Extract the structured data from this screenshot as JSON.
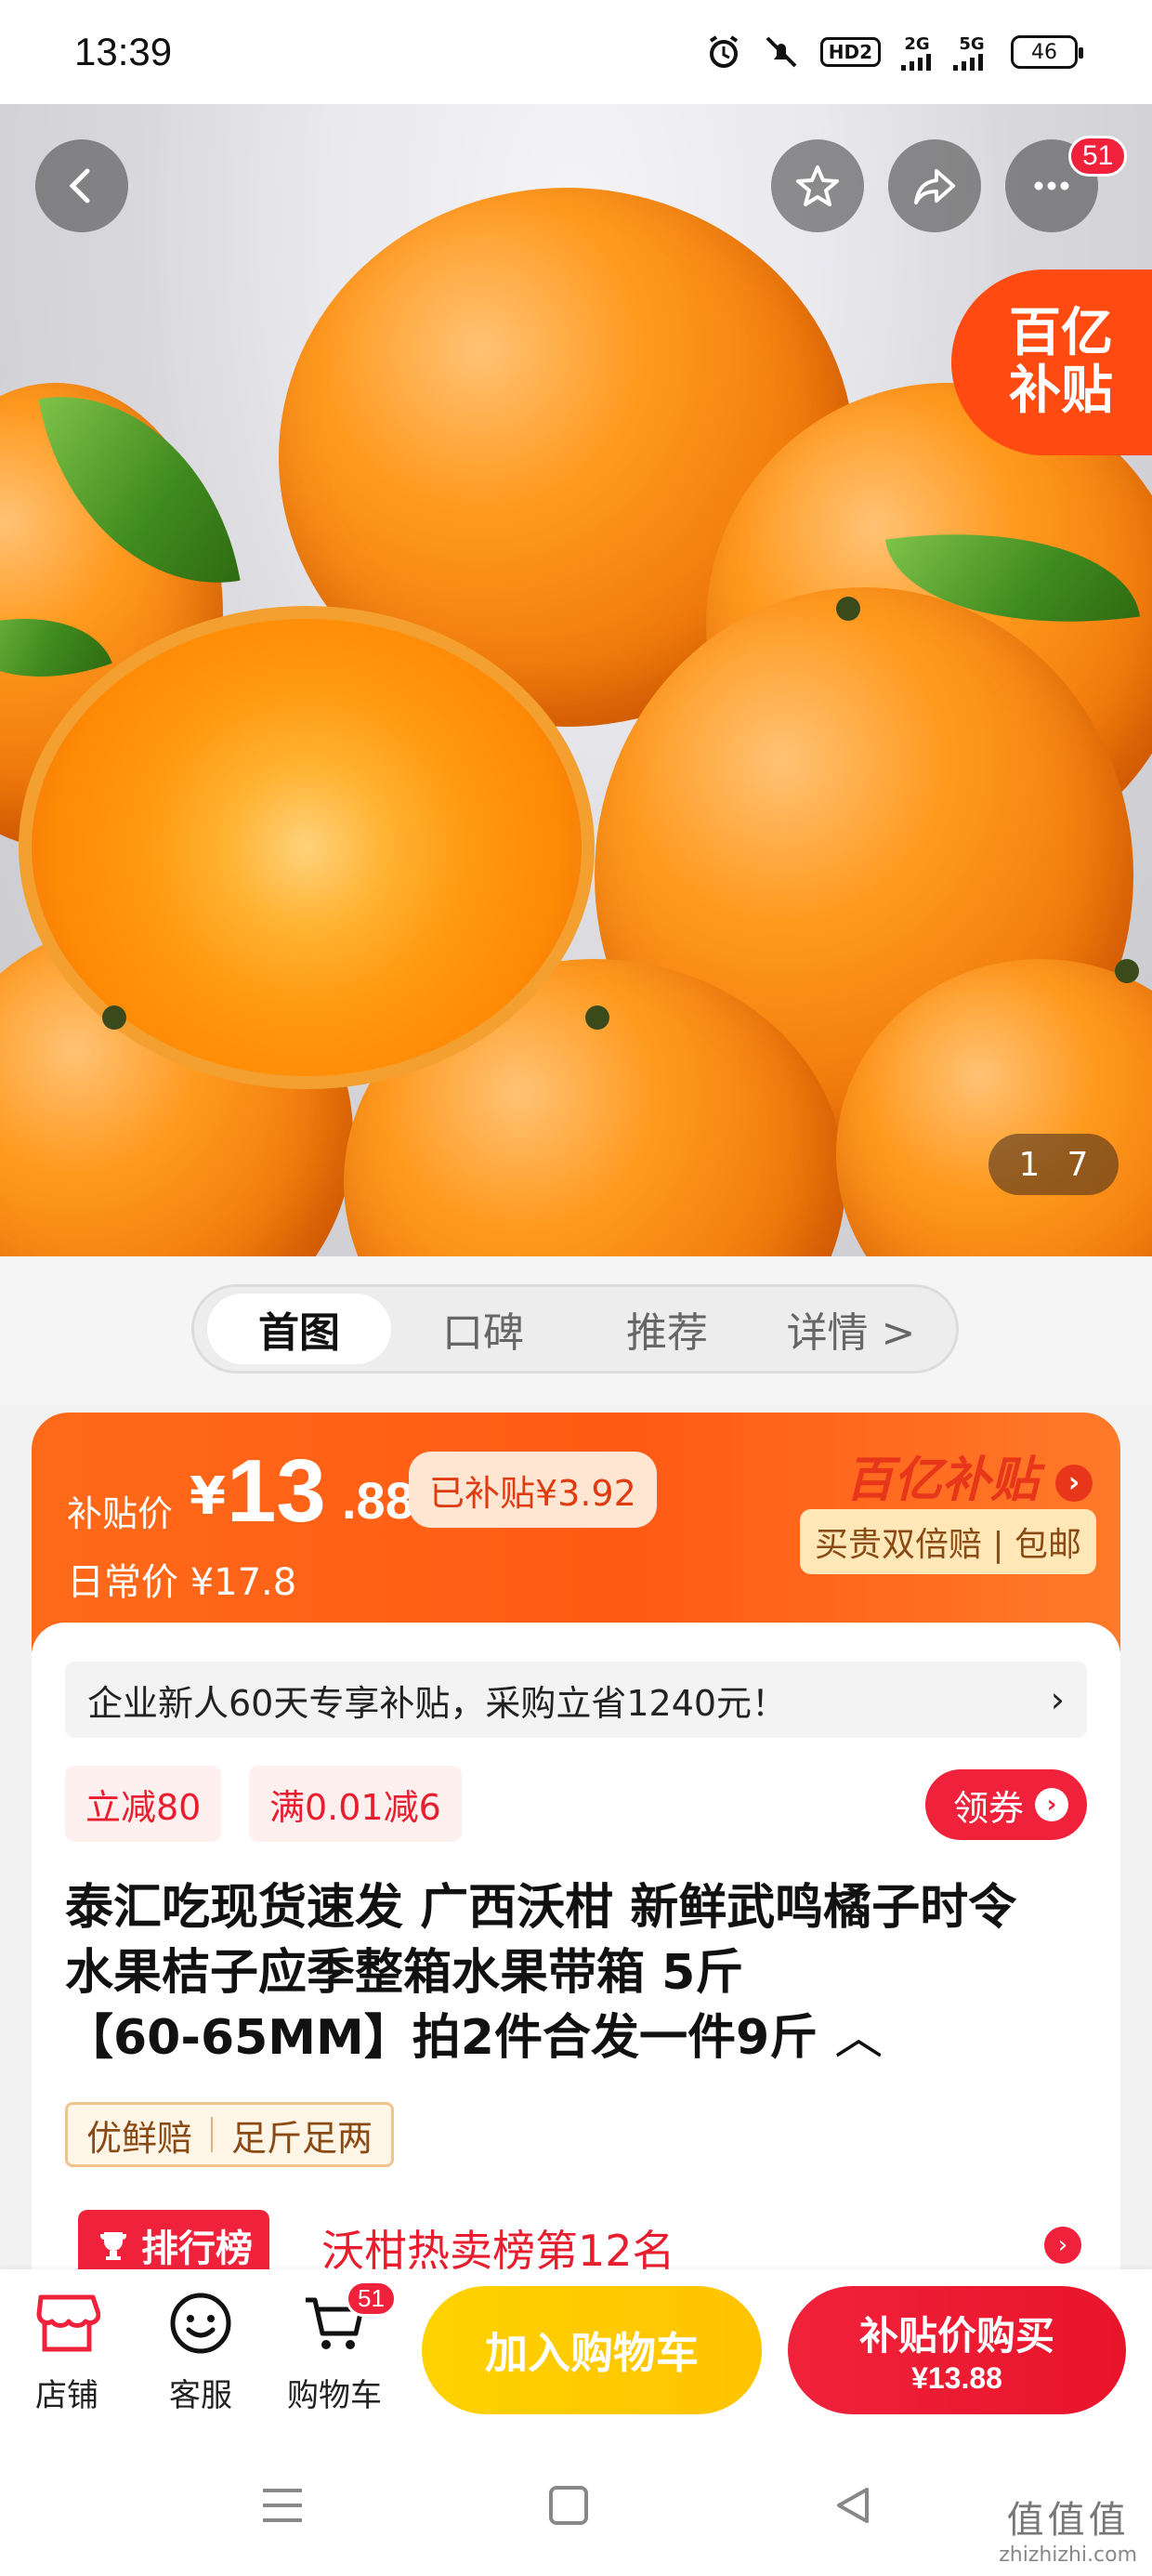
{
  "status_bar": {
    "time": "13:39",
    "hd_label": "HD2",
    "network_2g": "2G",
    "network_5g": "5G",
    "battery": "46"
  },
  "hero": {
    "more_badge": "51",
    "subsidy_line1": "百亿",
    "subsidy_line2": "补贴",
    "page_current": "1",
    "page_total": "7"
  },
  "tabs": [
    {
      "label": "首图"
    },
    {
      "label": "口碑"
    },
    {
      "label": "推荐"
    },
    {
      "label": "详情 >"
    }
  ],
  "price": {
    "label": "补贴价",
    "currency": "¥",
    "integer": "13",
    "decimal": ".88",
    "subsidy_chip": "已补贴¥3.92",
    "daily_price": "日常价 ¥17.8",
    "brand": "百亿补贴",
    "guarantee": "买贵双倍赔 | 包邮"
  },
  "details": {
    "promo": "企业新人60天专享补贴，采购立省1240元！",
    "coupons": [
      "立减80",
      "满0.01减6"
    ],
    "get_coupon": "领券",
    "title_line1": "泰汇吃现货速发 广西沃柑 新鲜武鸣橘子时令",
    "title_line2": "水果桔子应季整箱水果带箱 5斤",
    "title_line3": "【60-65MM】拍2件合发一件9斤",
    "tags": [
      "优鲜赔",
      "足斤足两"
    ],
    "rank_badge": "排行榜",
    "rank_text": "沃柑热卖榜第12名"
  },
  "bottom_bar": {
    "store": "店铺",
    "service": "客服",
    "cart": "购物车",
    "cart_badge": "51",
    "add_to_cart": "加入购物车",
    "buy_line1": "补贴价购买",
    "buy_line2": "¥13.88"
  },
  "watermark": {
    "line1": "值值值",
    "line2": "zhizhizhi.com"
  },
  "colors": {
    "accent_red": "#f0223b",
    "subsidy_orange": "#ff5a14",
    "cart_yellow": "#ffc300"
  }
}
